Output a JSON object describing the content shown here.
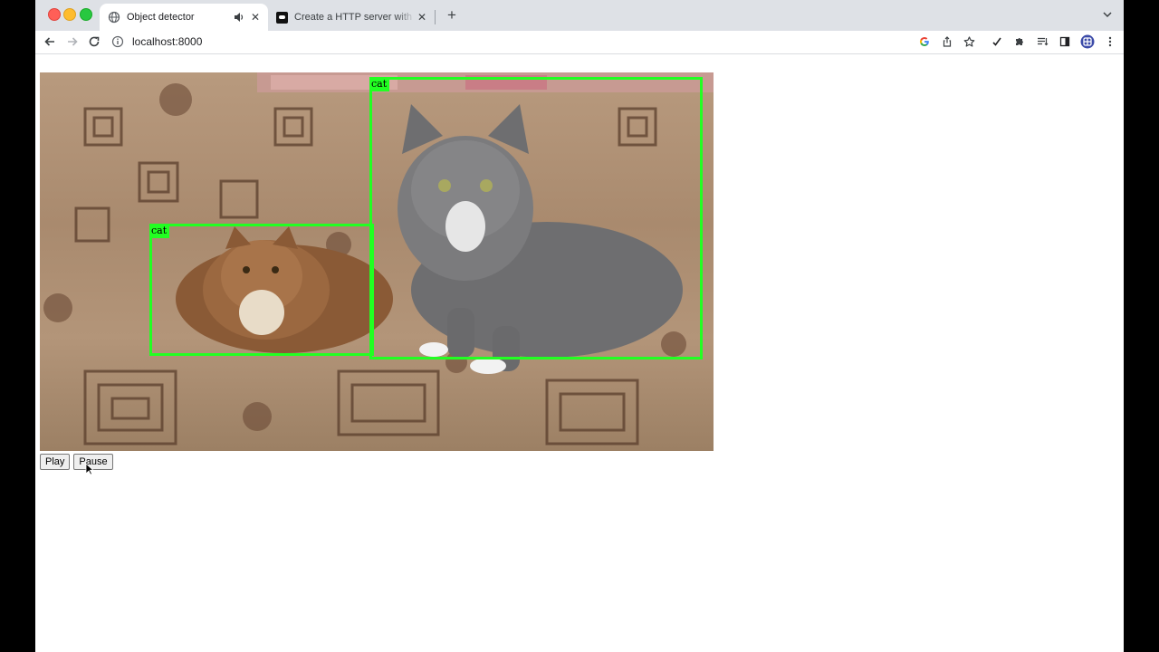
{
  "browser": {
    "tabs": [
      {
        "title": "Object detector",
        "active": true,
        "audio": true
      },
      {
        "title": "Create a HTTP server with one",
        "active": false
      }
    ],
    "address": "localhost:8000",
    "icons": [
      "back-icon",
      "forward-icon",
      "reload-icon",
      "info-icon",
      "google-icon",
      "share-icon",
      "star-icon",
      "check-icon",
      "puzzle-icon",
      "reading-list-icon",
      "side-panel-icon",
      "profile-icon",
      "more-icon"
    ]
  },
  "detections": [
    {
      "label": "cat"
    },
    {
      "label": "cat"
    }
  ],
  "controls": {
    "play_label": "Play",
    "pause_label": "Pause"
  },
  "colors": {
    "bbox": "#22ff22",
    "tabstrip": "#dee1e6"
  }
}
